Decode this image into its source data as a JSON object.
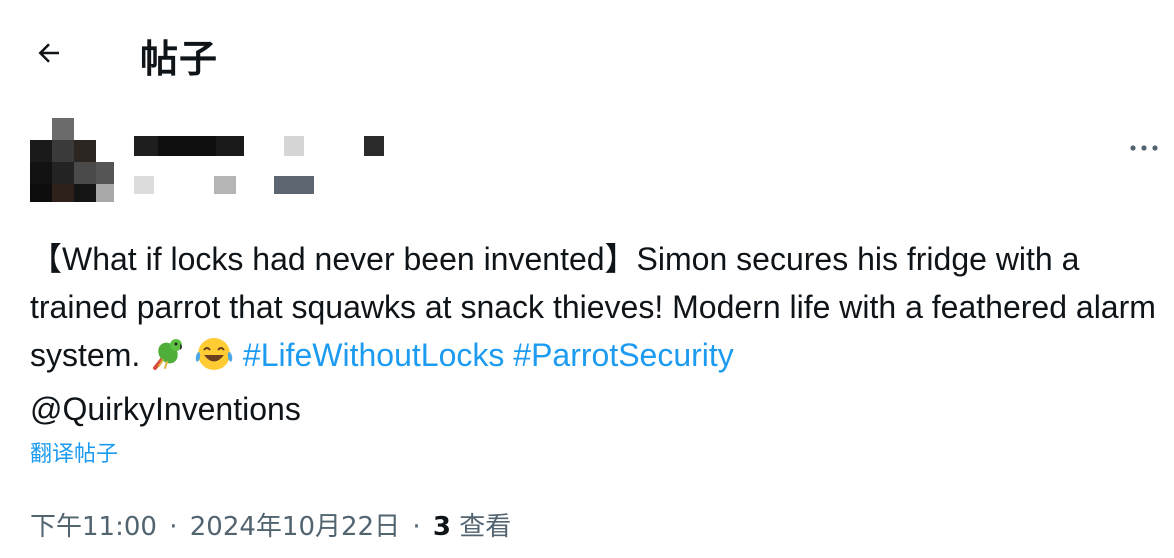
{
  "header": {
    "back_icon": "arrow-left-icon",
    "title": "帖子"
  },
  "author": {
    "avatar": "pixelated-avatar",
    "display_name_redacted": true,
    "handle_redacted": true,
    "more_icon": "more-horizontal-icon"
  },
  "post": {
    "text_main": "【What if locks had never been invented】Simon secures his fridge with a trained parrot that squawks at snack thieves! Modern life with a feathered alarm system. ",
    "emojis": [
      "parrot-emoji",
      "tears-of-joy-emoji"
    ],
    "hashtags": [
      "#LifeWithoutLocks",
      "#ParrotSecurity"
    ],
    "mention": "@QuirkyInventions",
    "translate_label": "翻译帖子"
  },
  "meta": {
    "time": "下午11:00",
    "date": "2024年10月22日",
    "separator": "·",
    "views_count": "3",
    "views_label": "查看"
  },
  "colors": {
    "link": "#1d9bf0",
    "text": "#0f1419",
    "secondary": "#536471"
  }
}
